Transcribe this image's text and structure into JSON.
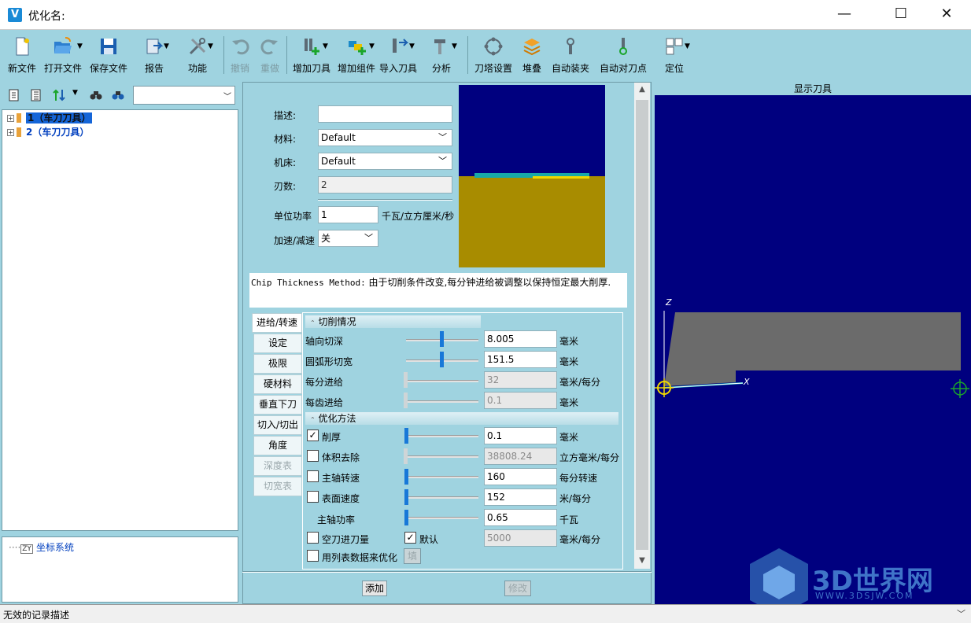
{
  "window": {
    "app_icon": "V",
    "title": "优化名:",
    "minimize": "—",
    "maximize": "☐",
    "close": "✕"
  },
  "toolbar": [
    {
      "label": "新文件",
      "icon": "new-file-icon",
      "enabled": true
    },
    {
      "label": "打开文件",
      "icon": "open-folder-icon",
      "enabled": true
    },
    {
      "label": "保存文件",
      "icon": "save-icon",
      "enabled": true
    },
    {
      "label": "报告",
      "icon": "report-icon",
      "enabled": true
    },
    {
      "label": "功能",
      "icon": "tools-icon",
      "enabled": true
    },
    {
      "label": "撤销",
      "icon": "undo-icon",
      "enabled": false
    },
    {
      "label": "重做",
      "icon": "redo-icon",
      "enabled": false
    },
    {
      "label": "增加刀具",
      "icon": "add-tool-icon",
      "enabled": true
    },
    {
      "label": "增加组件",
      "icon": "add-component-icon",
      "enabled": true
    },
    {
      "label": "导入刀具",
      "icon": "import-tool-icon",
      "enabled": true
    },
    {
      "label": "分析",
      "icon": "analysis-icon",
      "enabled": true
    },
    {
      "label": "刀塔设置",
      "icon": "turret-icon",
      "enabled": true
    },
    {
      "label": "堆叠",
      "icon": "stack-icon",
      "enabled": true
    },
    {
      "label": "自动装夹",
      "icon": "auto-clamp-icon",
      "enabled": true
    },
    {
      "label": "自动对刀点",
      "icon": "auto-probe-icon",
      "enabled": true
    },
    {
      "label": "定位",
      "icon": "locate-icon",
      "enabled": true
    }
  ],
  "left": {
    "combo_value": "",
    "tree": [
      {
        "label": "1（车刀刀具）",
        "selected": true
      },
      {
        "label": "2（车刀刀具）",
        "selected": false
      }
    ],
    "coord_label": "坐标系统",
    "coord_icon_text": "ZY"
  },
  "form": {
    "desc_label": "描述:",
    "desc_value": "",
    "material_label": "材料:",
    "material_value": "Default",
    "machine_label": "机床:",
    "machine_value": "Default",
    "teeth_label": "刃数:",
    "teeth_value": "2",
    "unit_power_label": "单位功率",
    "unit_power_value": "1",
    "unit_power_unit": "千瓦/立方厘米/秒",
    "accel_label": "加速/减速",
    "accel_value": "关"
  },
  "chip_note": {
    "method": "Chip Thickness Method:",
    "text": " 由于切削条件改变,每分钟进给被调整以保持恒定最大削厚."
  },
  "tabs": [
    {
      "label": "进给/转速",
      "active": true,
      "enabled": true
    },
    {
      "label": "设定",
      "active": false,
      "enabled": true
    },
    {
      "label": "极限",
      "active": false,
      "enabled": true
    },
    {
      "label": "硬材料",
      "active": false,
      "enabled": true
    },
    {
      "label": "垂直下刀",
      "active": false,
      "enabled": true
    },
    {
      "label": "切入/切出",
      "active": false,
      "enabled": true
    },
    {
      "label": "角度",
      "active": false,
      "enabled": true
    },
    {
      "label": "深度表",
      "active": false,
      "enabled": false
    },
    {
      "label": "切宽表",
      "active": false,
      "enabled": false
    }
  ],
  "cutting": {
    "header": "切削情况",
    "rows": [
      {
        "label": "轴向切深",
        "value": "8.005",
        "unit": "毫米",
        "enabled": true
      },
      {
        "label": "圆弧形切宽",
        "value": "151.5",
        "unit": "毫米",
        "enabled": true
      },
      {
        "label": "每分进给",
        "value": "32",
        "unit": "毫米/每分",
        "enabled": false
      },
      {
        "label": "每齿进给",
        "value": "0.1",
        "unit": "毫米",
        "enabled": false
      }
    ]
  },
  "optimize": {
    "header": "优化方法",
    "rows": [
      {
        "label": "削厚",
        "checked": true,
        "has_check": true,
        "value": "0.1",
        "unit": "毫米",
        "enabled": true
      },
      {
        "label": "体积去除",
        "checked": false,
        "has_check": true,
        "value": "38808.24",
        "unit": "立方毫米/每分",
        "enabled": false
      },
      {
        "label": "主轴转速",
        "checked": false,
        "has_check": true,
        "value": "160",
        "unit": "每分转速",
        "enabled": true
      },
      {
        "label": "表面速度",
        "checked": false,
        "has_check": true,
        "value": "152",
        "unit": "米/每分",
        "enabled": true
      },
      {
        "label": "主轴功率",
        "checked": false,
        "has_check": false,
        "value": "0.65",
        "unit": "千瓦",
        "enabled": true
      }
    ],
    "air_cut_label": "空刀进刀量",
    "air_cut_checked": false,
    "default_label": "默认",
    "default_checked": true,
    "air_cut_value": "5000",
    "air_cut_unit": "毫米/每分",
    "use_table_label": "用列表数据来优化",
    "fill_label": "填"
  },
  "buttons": {
    "add": "添加",
    "modify": "修改"
  },
  "view": {
    "title": "显示刀具",
    "axis_z": "Z",
    "axis_x": "X"
  },
  "watermark": {
    "text": "3D世界网",
    "url": "WWW.3DSJW.COM"
  },
  "status": {
    "text": "无效的记录描述"
  },
  "colors": {
    "panel_bg": "#9fd3e0",
    "viewport_bg": "#00007f",
    "tool_gray": "#6b6b6b",
    "stock_gold": "#a88c00",
    "accent_blue": "#1878d8"
  }
}
